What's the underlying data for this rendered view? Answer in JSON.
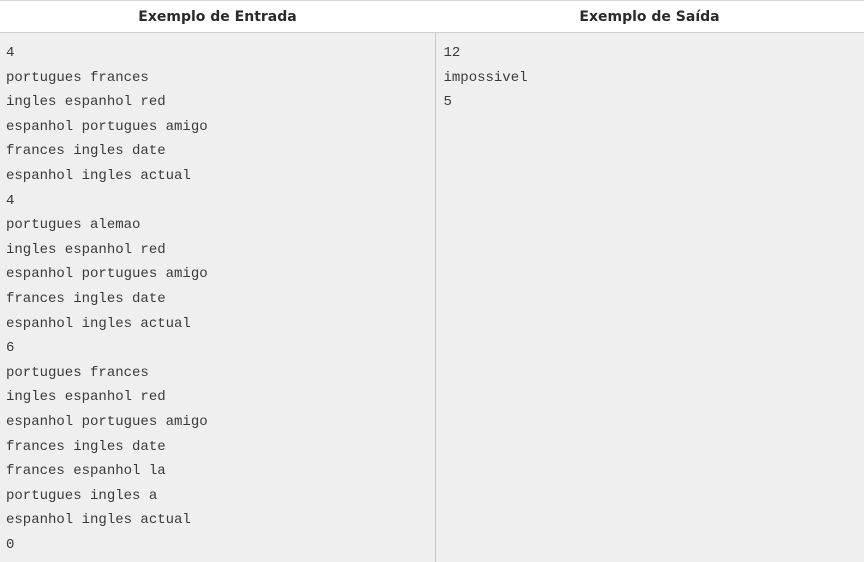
{
  "headers": {
    "input": "Exemplo de Entrada",
    "output": "Exemplo de Saída"
  },
  "input_lines": [
    "4",
    "portugues frances",
    "ingles espanhol red",
    "espanhol portugues amigo",
    "frances ingles date",
    "espanhol ingles actual",
    "4",
    "portugues alemao",
    "ingles espanhol red",
    "espanhol portugues amigo",
    "frances ingles date",
    "espanhol ingles actual",
    "6",
    "portugues frances",
    "ingles espanhol red",
    "espanhol portugues amigo",
    "frances ingles date",
    "frances espanhol la",
    "portugues ingles a",
    "espanhol ingles actual",
    "0"
  ],
  "output_lines": [
    "12",
    "impossivel",
    "5"
  ]
}
